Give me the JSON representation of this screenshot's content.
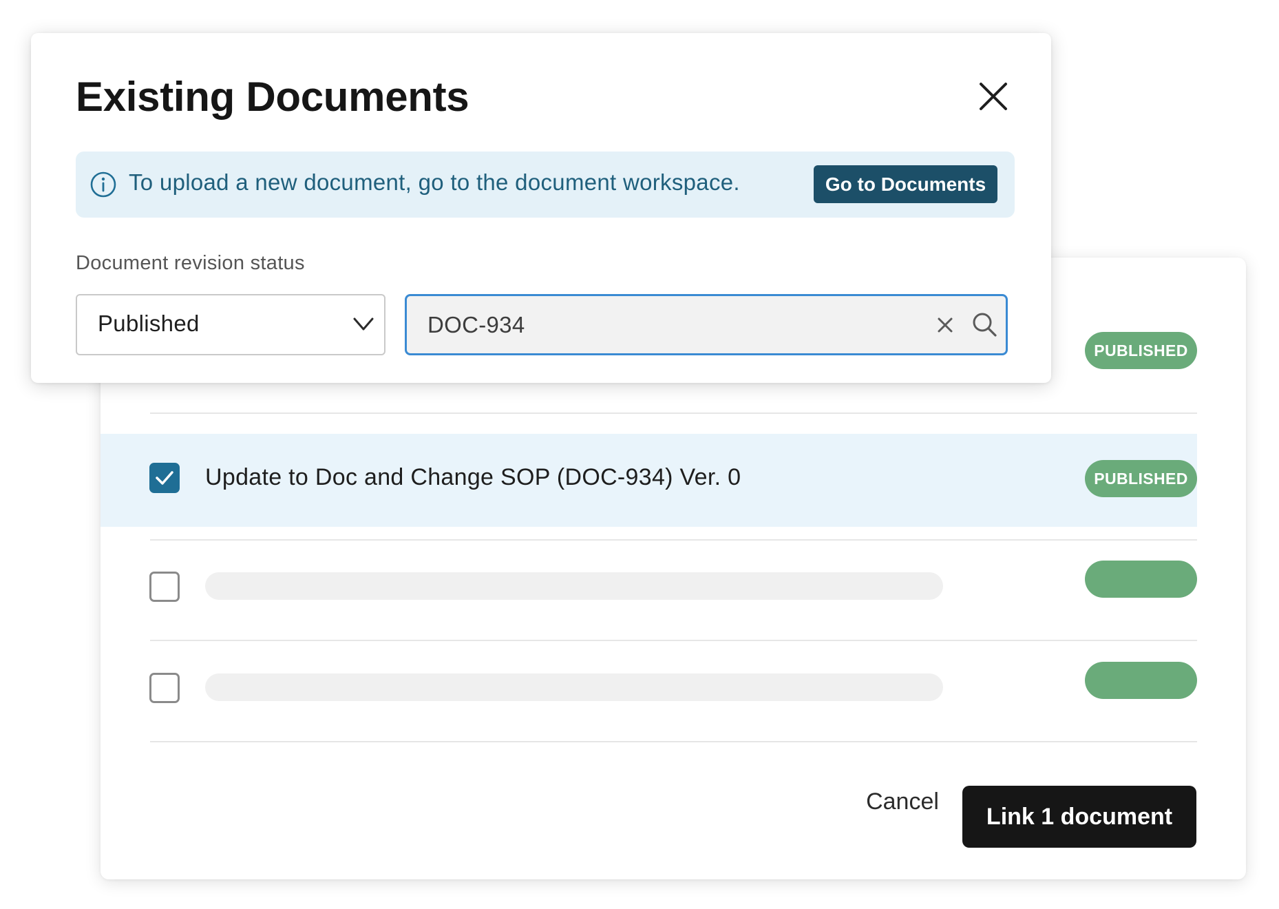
{
  "modal": {
    "title": "Existing Documents",
    "close_icon": "close-icon"
  },
  "banner": {
    "icon": "info-icon",
    "text": "To upload a new document, go to the document workspace.",
    "button_label": "Go to Documents"
  },
  "filters": {
    "status_label": "Document revision status",
    "status_selected": "Published",
    "search_value": "DOC-934",
    "clear_icon": "clear-icon",
    "search_icon": "search-icon"
  },
  "list": {
    "rows": [
      {
        "label": "",
        "status": "PUBLISHED",
        "checked": false,
        "placeholder": false
      },
      {
        "label": "Update to Doc and Change SOP (DOC-934) Ver. 0",
        "status": "PUBLISHED",
        "checked": true,
        "placeholder": false
      },
      {
        "label": "",
        "status": "",
        "checked": false,
        "placeholder": true
      },
      {
        "label": "",
        "status": "",
        "checked": false,
        "placeholder": true
      }
    ]
  },
  "footer": {
    "cancel_label": "Cancel",
    "confirm_label": "Link 1 document"
  },
  "colors": {
    "primary_dark": "#161616",
    "accent_blue": "#1f6e95",
    "banner_bg": "#e4f1f8",
    "published_green": "#6aab7a",
    "selected_row_bg": "#e9f4fb"
  }
}
